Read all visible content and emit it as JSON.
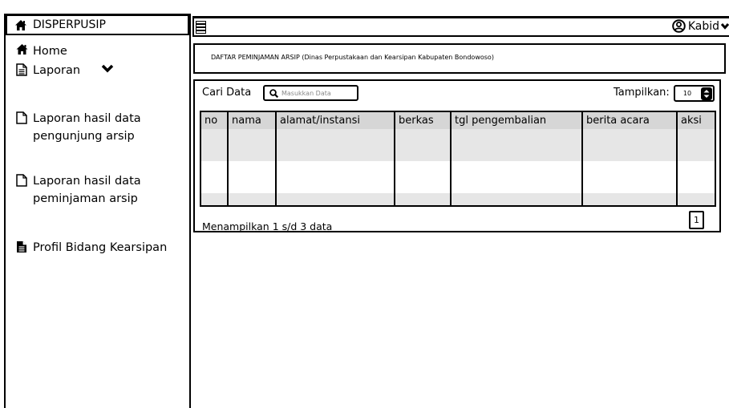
{
  "sidebar": {
    "brand": "DISPERPUSIP",
    "items": [
      {
        "label": "Home",
        "icon": "home-icon"
      },
      {
        "label": "Laporan",
        "icon": "document-icon"
      },
      {
        "label": "Laporan hasil data",
        "label2": "pengunjung arsip",
        "icon": "file-icon"
      },
      {
        "label": "Laporan hasil data",
        "label2": "peminjaman arsip",
        "icon": "file-icon"
      },
      {
        "label": "Profil Bidang Kearsipan",
        "icon": "file-solid-icon"
      }
    ]
  },
  "topbar": {
    "user": "Kabid"
  },
  "main": {
    "title": "DAFTAR PEMINJAMAN ARSIP (Dinas Perpustakaan dan Kearsipan Kabupaten Bondowoso)",
    "search_label": "Cari Data",
    "search_placeholder": "Masukkan Data",
    "show_label": "Tampilkan:",
    "show_value": "10",
    "columns": [
      "no",
      "nama",
      "alamat/instansi",
      "berkas",
      "tgl pengembalian",
      "berita acara",
      "aksi"
    ],
    "footer": "Menampilkan 1 s/d 3 data",
    "page": "1"
  }
}
